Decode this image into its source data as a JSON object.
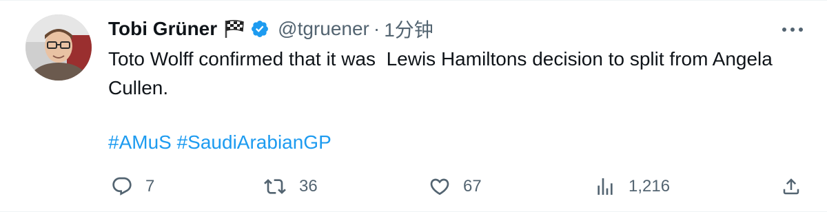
{
  "tweet": {
    "author": {
      "display_name": "Tobi Grüner",
      "flag_emoji_icon": "chequered-flag-icon",
      "verified_icon": "verified-badge-icon",
      "handle": "@tgruener",
      "separator": "·",
      "time": "1分钟"
    },
    "text": "Toto Wolff confirmed that it was  Lewis Hamiltons decision to split from Angela Cullen.",
    "hashtags": [
      "#AMuS",
      "#SaudiArabianGP"
    ],
    "actions": {
      "reply_count": "7",
      "retweet_count": "36",
      "like_count": "67",
      "views_count": "1,216"
    }
  },
  "colors": {
    "text": "#0f1419",
    "secondary": "#536471",
    "accent": "#1d9bf0"
  }
}
